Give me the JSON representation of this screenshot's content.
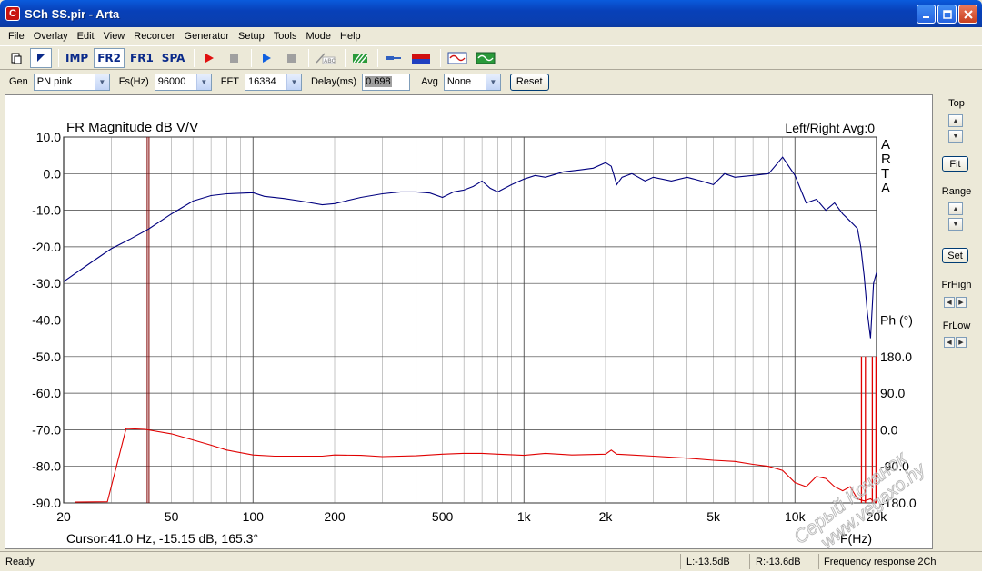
{
  "window": {
    "title": "SCh SS.pir - Arta",
    "app_icon_glyph": "C",
    "minimize": "0",
    "maximize": "1",
    "close": "r"
  },
  "menu": [
    "File",
    "Overlay",
    "Edit",
    "View",
    "Recorder",
    "Generator",
    "Setup",
    "Tools",
    "Mode",
    "Help"
  ],
  "toolbar": {
    "imp": "IMP",
    "fr2": "FR2",
    "fr1": "FR1",
    "spa": "SPA"
  },
  "settings": {
    "gen_label": "Gen",
    "gen_value": "PN pink",
    "fs_label": "Fs(Hz)",
    "fs_value": "96000",
    "fft_label": "FFT",
    "fft_value": "16384",
    "delay_label": "Delay(ms)",
    "delay_value": "0.698",
    "avg_label": "Avg",
    "avg_value": "None",
    "reset_label": "Reset"
  },
  "right_panel": {
    "top_label": "Top",
    "fit_label": "Fit",
    "range_label": "Range",
    "set_label": "Set",
    "frhigh_label": "FrHigh",
    "frlow_label": "FrLow"
  },
  "status": {
    "ready": "Ready",
    "left": "L:-13.5dB",
    "right": "R:-13.6dB",
    "mode": "Frequency response 2Ch"
  },
  "watermark": {
    "line1": "Серый Кочанок",
    "line2": "www.vegaxo.hy"
  },
  "colors": {
    "magnitude": "#00007f",
    "phase": "#e00000",
    "cursor": "#800000",
    "grid": "#a0a0a0"
  },
  "chart_data": {
    "type": "line",
    "title": "FR Magnitude dB V/V",
    "channel_label": "Left/Right  Avg:0",
    "brand": [
      "A",
      "R",
      "T",
      "A"
    ],
    "xlabel": "F(Hz)",
    "ylabel_right": "Ph (°)",
    "xscale": "log",
    "xlim": [
      20,
      20000
    ],
    "ylim": [
      -90,
      10
    ],
    "phase_lim": [
      -180,
      180
    ],
    "x_ticks": [
      20,
      50,
      100,
      200,
      500,
      1000,
      2000,
      5000,
      10000,
      20000
    ],
    "x_tick_labels": [
      "20",
      "50",
      "100",
      "200",
      "500",
      "1k",
      "2k",
      "5k",
      "10k",
      "20k"
    ],
    "y_ticks": [
      10,
      0,
      -10,
      -20,
      -30,
      -40,
      -50,
      -60,
      -70,
      -80,
      -90
    ],
    "y_tick_labels": [
      "10.0",
      "0.0",
      "-10.0",
      "-20.0",
      "-30.0",
      "-40.0",
      "-50.0",
      "-60.0",
      "-70.0",
      "-80.0",
      "-90.0"
    ],
    "phase_ticks": [
      180,
      90,
      0,
      -90,
      -180
    ],
    "phase_tick_labels": [
      "180.0",
      "90.0",
      "0.0",
      "-90.0",
      "-180.0"
    ],
    "cursor": {
      "freq": 41.0,
      "text": "Cursor:41.0 Hz, -15.15 dB, 165.3°"
    },
    "grid": true,
    "series": [
      {
        "name": "Magnitude",
        "axis": "left",
        "x": [
          20,
          25,
          30,
          35,
          41,
          50,
          60,
          70,
          80,
          100,
          110,
          130,
          150,
          180,
          200,
          250,
          300,
          350,
          400,
          450,
          500,
          550,
          600,
          650,
          700,
          750,
          800,
          900,
          1000,
          1100,
          1200,
          1400,
          1600,
          1800,
          2000,
          2100,
          2200,
          2300,
          2500,
          2800,
          3000,
          3500,
          4000,
          4500,
          5000,
          5500,
          6000,
          7000,
          8000,
          9000,
          10000,
          11000,
          12000,
          13000,
          14000,
          15000,
          16000,
          17000,
          17500,
          18000,
          18500,
          19000,
          19500,
          20000
        ],
        "y": [
          -29.5,
          -24.5,
          -20.5,
          -18,
          -15.2,
          -11,
          -7.5,
          -6,
          -5.5,
          -5.2,
          -6.2,
          -6.8,
          -7.5,
          -8.5,
          -8.2,
          -6.5,
          -5.5,
          -5,
          -5,
          -5.3,
          -6.5,
          -5,
          -4.5,
          -3.5,
          -2,
          -4,
          -5,
          -3,
          -1.5,
          -0.5,
          -1,
          0.5,
          1,
          1.5,
          3,
          2,
          -3,
          -1,
          0,
          -2,
          -1,
          -2,
          -1,
          -2,
          -3,
          0,
          -1,
          -0.5,
          0,
          4.5,
          -0.5,
          -8,
          -7,
          -10,
          -8,
          -11,
          -13,
          -15,
          -20,
          -28,
          -38,
          -45,
          -30,
          -27
        ]
      },
      {
        "name": "Phase",
        "axis": "right",
        "x": [
          22,
          29,
          34,
          40,
          50,
          60,
          70,
          80,
          100,
          120,
          150,
          180,
          200,
          250,
          300,
          400,
          500,
          600,
          700,
          800,
          1000,
          1200,
          1500,
          2000,
          2100,
          2200,
          2500,
          3000,
          4000,
          5000,
          6000,
          7000,
          8000,
          9000,
          10000,
          11000,
          12000,
          13000,
          14000,
          15000,
          16000,
          17000,
          18000,
          19000,
          20000
        ],
        "y": [
          -178,
          -177,
          3,
          1,
          -10,
          -25,
          -38,
          -50,
          -62,
          -65,
          -65,
          -65,
          -62,
          -63,
          -66,
          -64,
          -60,
          -58,
          -58,
          -60,
          -63,
          -58,
          -62,
          -60,
          -50,
          -60,
          -62,
          -65,
          -70,
          -75,
          -78,
          -85,
          -90,
          -100,
          -130,
          -140,
          -115,
          -120,
          -140,
          -150,
          -140,
          -170,
          -175,
          -170,
          -180
        ]
      }
    ]
  }
}
